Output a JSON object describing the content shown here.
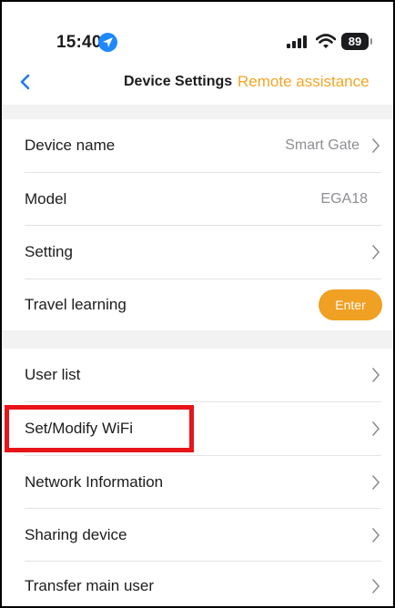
{
  "status_bar": {
    "time": "15:40",
    "battery": "89",
    "location_icon": "location-arrow-icon",
    "signal_icon": "cellular-signal-icon",
    "wifi_icon": "wifi-icon"
  },
  "nav": {
    "back_icon": "chevron-left-icon",
    "title": "Device Settings",
    "remote_assistance": "Remote assistance"
  },
  "section1": [
    {
      "label": "Device name",
      "value": "Smart Gate",
      "chevron": true
    },
    {
      "label": "Model",
      "value": "EGA18",
      "chevron": false
    },
    {
      "label": "Setting",
      "value": "",
      "chevron": true
    },
    {
      "label": "Travel learning",
      "button": "Enter"
    }
  ],
  "section2": [
    {
      "label": "User list"
    },
    {
      "label": "Set/Modify WiFi"
    },
    {
      "label": "Network Information"
    },
    {
      "label": "Sharing device"
    },
    {
      "label": "Transfer main user"
    }
  ],
  "colors": {
    "accent": "#f0a022",
    "highlight": "#e8141a",
    "location_blue": "#1e88ff"
  }
}
